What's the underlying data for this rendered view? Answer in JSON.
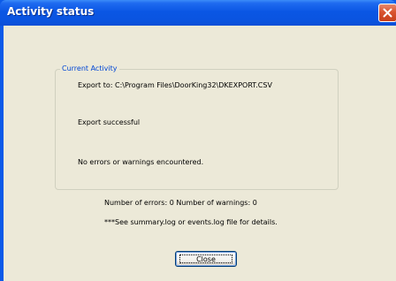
{
  "window": {
    "title": "Activity status",
    "close_icon": "close-icon",
    "colors": {
      "titlebar": "#0a54e0",
      "client": "#ece9d8",
      "group_title": "#0046d5",
      "close_button": "#d9542f"
    }
  },
  "group": {
    "title": "Current Activity",
    "export_line": "Export to: C:\\Program Files\\DoorKing32\\DKEXPORT.CSV",
    "status_line": "Export successful",
    "errors_line": "No errors or warnings encountered."
  },
  "summary": {
    "counts_line": "Number of errors: 0   Number of warnings: 0",
    "log_note": "***See summary.log or events.log file for details."
  },
  "buttons": {
    "close_label": "Close"
  }
}
